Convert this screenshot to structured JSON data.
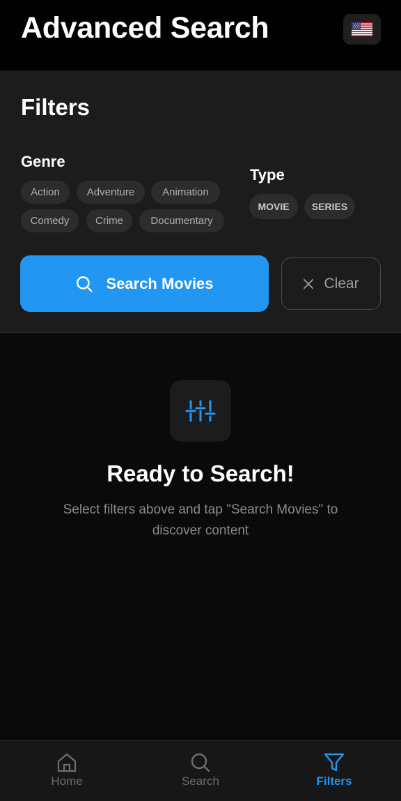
{
  "header": {
    "title": "Advanced Search",
    "flag_icon": "flag-us-icon",
    "flag_glyph": "🇺🇸"
  },
  "filters": {
    "heading": "Filters",
    "genre_label": "Genre",
    "genres": [
      "Action",
      "Adventure",
      "Animation",
      "Comedy",
      "Crime",
      "Documentary"
    ],
    "type_label": "Type",
    "types": [
      "MOVIE",
      "SERIES"
    ]
  },
  "actions": {
    "search_label": "Search Movies",
    "search_icon": "search-icon",
    "clear_label": "Clear",
    "clear_icon": "close-icon"
  },
  "empty_state": {
    "icon": "sliders-icon",
    "title": "Ready to Search!",
    "subtitle": "Select filters above and tap \"Search Movies\" to discover content"
  },
  "bottom_nav": {
    "items": [
      {
        "label": "Home",
        "icon": "home-icon",
        "active": false
      },
      {
        "label": "Search",
        "icon": "search-icon",
        "active": false
      },
      {
        "label": "Filters",
        "icon": "filter-icon",
        "active": true
      }
    ]
  },
  "colors": {
    "accent": "#2196f3",
    "background": "#0a0a0a",
    "panel": "#1c1c1c",
    "chip": "#2c2c2c"
  }
}
